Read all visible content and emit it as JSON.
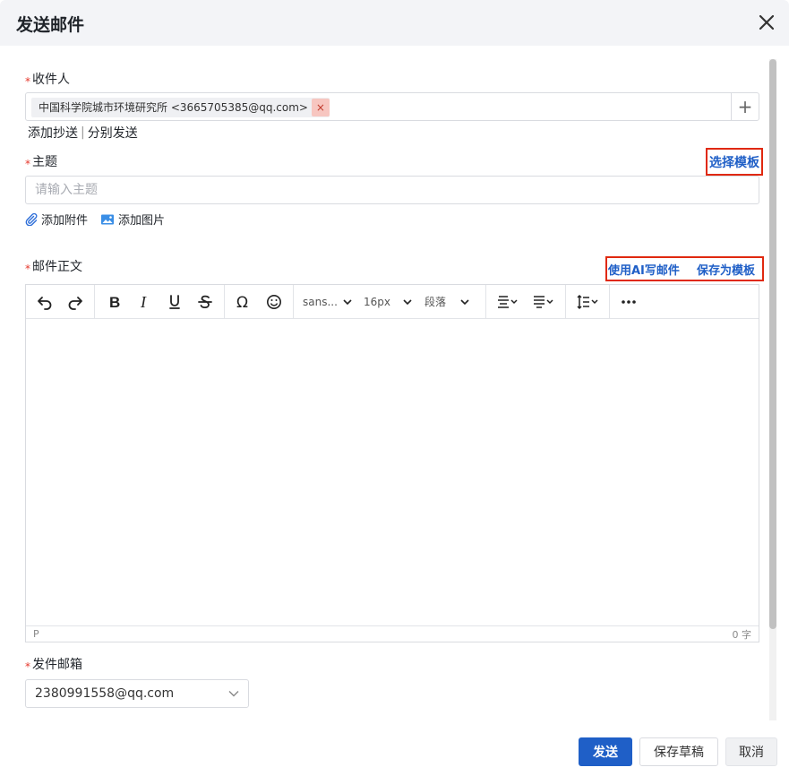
{
  "dialog": {
    "title": "发送邮件"
  },
  "recipients": {
    "label": "收件人",
    "required_mark": "*",
    "tags": [
      "中国科学院城市环境研究所 <3665705385@qq.com>"
    ],
    "tag_remove": "×",
    "add_symbol": "+",
    "add_cc": "添加抄送",
    "separator": "|",
    "send_separately": "分别发送"
  },
  "subject": {
    "label": "主题",
    "required_mark": "*",
    "placeholder": "请输入主题",
    "value": "",
    "select_template": "选择模板"
  },
  "attachments": {
    "add_attachment": "添加附件",
    "add_image": "添加图片"
  },
  "body": {
    "label": "邮件正文",
    "required_mark": "*",
    "ai_write": "使用AI写邮件",
    "save_template": "保存为模板",
    "toolbar": {
      "font_family": "sans...",
      "font_size": "16px",
      "block_format": "段落"
    },
    "status_path": "P",
    "word_count": "0 字"
  },
  "sender": {
    "label": "发件邮箱",
    "required_mark": "*",
    "value": "2380991558@qq.com"
  },
  "footer": {
    "send": "发送",
    "save_draft": "保存草稿",
    "cancel": "取消"
  },
  "colors": {
    "accent": "#1f5fc7",
    "highlight_box": "#e0290f",
    "required": "#e5372b"
  }
}
